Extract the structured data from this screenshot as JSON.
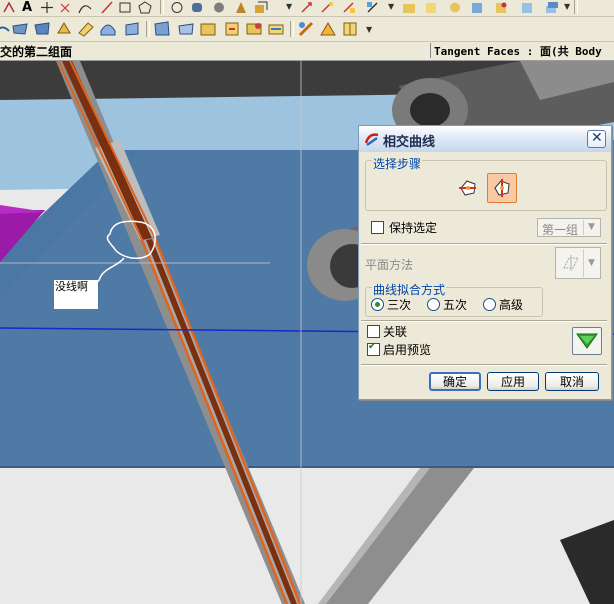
{
  "statusbar": {
    "prompt": "交的第二组面",
    "filter_text": "Tangent Faces : 面(共 Body"
  },
  "annotation": {
    "text": "没线啊"
  },
  "dialog": {
    "title": "相交曲线",
    "steps_group": "选择步骤",
    "keep_selected_label": "保持选定",
    "keep_selected_checked": false,
    "set_combo_value": "第一组",
    "plane_method_label": "平面方法",
    "fit_group": "曲线拟合方式",
    "fit_options": [
      "三次",
      "五次",
      "高级"
    ],
    "fit_selected": "三次",
    "associative_label": "关联",
    "associative_checked": false,
    "preview_label": "启用预览",
    "preview_checked": true,
    "ok_label": "确定",
    "apply_label": "应用",
    "cancel_label": "取消"
  },
  "colors": {
    "viewport_bg": "#9ec3df",
    "face_blue": "#4e7aa5",
    "edge_orange": "#e0641e",
    "highlight_purple": "#9b1aa8"
  }
}
